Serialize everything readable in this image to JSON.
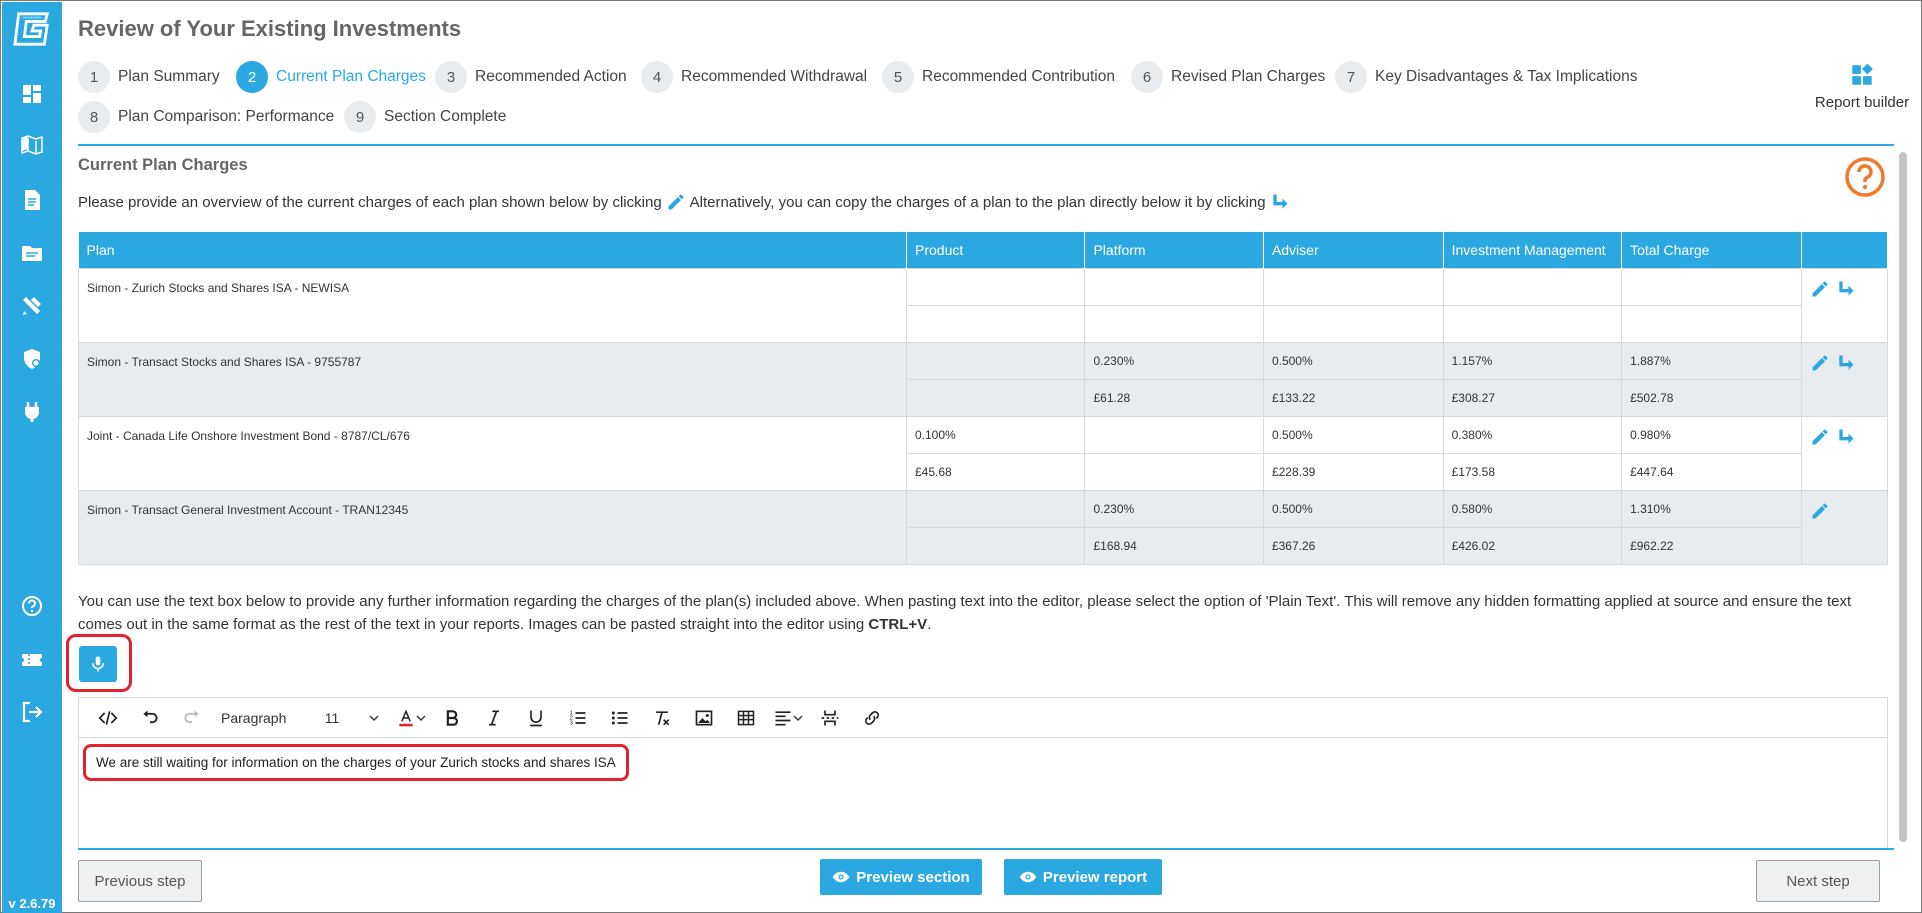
{
  "app": {
    "version": "v 2.6.79",
    "accent": "#2ba8e0",
    "highlight": "#e2232f"
  },
  "sidebar": {
    "items": [
      {
        "name": "dashboard-icon"
      },
      {
        "name": "book-map-icon"
      },
      {
        "name": "document-icon"
      },
      {
        "name": "folder-icon"
      },
      {
        "name": "tools-icon"
      },
      {
        "name": "shield-user-icon"
      },
      {
        "name": "plug-icon"
      },
      {
        "name": "help-icon"
      },
      {
        "name": "ticket-icon"
      },
      {
        "name": "logout-icon"
      }
    ]
  },
  "page": {
    "title": "Review of Your Existing Investments",
    "report_builder_label": "Report builder"
  },
  "steps": [
    {
      "num": "1",
      "label": "Plan Summary",
      "active": false
    },
    {
      "num": "2",
      "label": "Current Plan Charges",
      "active": true
    },
    {
      "num": "3",
      "label": "Recommended Action",
      "active": false
    },
    {
      "num": "4",
      "label": "Recommended Withdrawal",
      "active": false
    },
    {
      "num": "5",
      "label": "Recommended Contribution",
      "active": false
    },
    {
      "num": "6",
      "label": "Revised Plan Charges",
      "active": false
    },
    {
      "num": "7",
      "label": "Key Disadvantages & Tax Implications",
      "active": false
    },
    {
      "num": "8",
      "label": "Plan Comparison: Performance",
      "active": false
    },
    {
      "num": "9",
      "label": "Section Complete",
      "active": false
    }
  ],
  "section": {
    "title": "Current Plan Charges",
    "instruction_part1": "Please provide an overview of the current charges of each plan shown below by clicking",
    "instruction_part2": "Alternatively, you can copy the charges of a plan to the plan directly below it by clicking"
  },
  "table": {
    "headers": [
      "Plan",
      "Product",
      "Platform",
      "Adviser",
      "Investment Management",
      "Total Charge"
    ],
    "rows": [
      {
        "plan": "Simon - Zurich Stocks and Shares ISA - NEWISA",
        "pct": [
          "",
          "",
          "",
          "",
          ""
        ],
        "amt": [
          "",
          "",
          "",
          "",
          ""
        ],
        "copy": true
      },
      {
        "plan": "Simon - Transact Stocks and Shares ISA - 9755787",
        "pct": [
          "",
          "0.230%",
          "0.500%",
          "1.157%",
          "1.887%"
        ],
        "amt": [
          "",
          "£61.28",
          "£133.22",
          "£308.27",
          "£502.78"
        ],
        "copy": true
      },
      {
        "plan": "Joint - Canada Life Onshore Investment Bond - 8787/CL/676",
        "pct": [
          "0.100%",
          "",
          "0.500%",
          "0.380%",
          "0.980%"
        ],
        "amt": [
          "£45.68",
          "",
          "£228.39",
          "£173.58",
          "£447.64"
        ],
        "copy": true
      },
      {
        "plan": "Simon - Transact General Investment Account - TRAN12345",
        "pct": [
          "",
          "0.230%",
          "0.500%",
          "0.580%",
          "1.310%"
        ],
        "amt": [
          "",
          "£168.94",
          "£367.26",
          "£426.02",
          "£962.22"
        ],
        "copy": false
      }
    ]
  },
  "notes": {
    "paragraph": "You can use the text box below to provide any further information regarding the charges of the plan(s) included above. When pasting text into the editor, please select the option of 'Plain Text'. This will remove any hidden formatting applied at source and ensure the text comes out in the same format as the rest of the text in your reports. Images can be pasted straight into the editor using ",
    "shortcut": "CTRL+V",
    "period": "."
  },
  "editor": {
    "block_format": "Paragraph",
    "font_size": "11",
    "content": "We are still waiting for information on the charges of your Zurich stocks and shares ISA"
  },
  "footer": {
    "previous": "Previous step",
    "preview_section": "Preview section",
    "preview_report": "Preview report",
    "next": "Next step"
  }
}
